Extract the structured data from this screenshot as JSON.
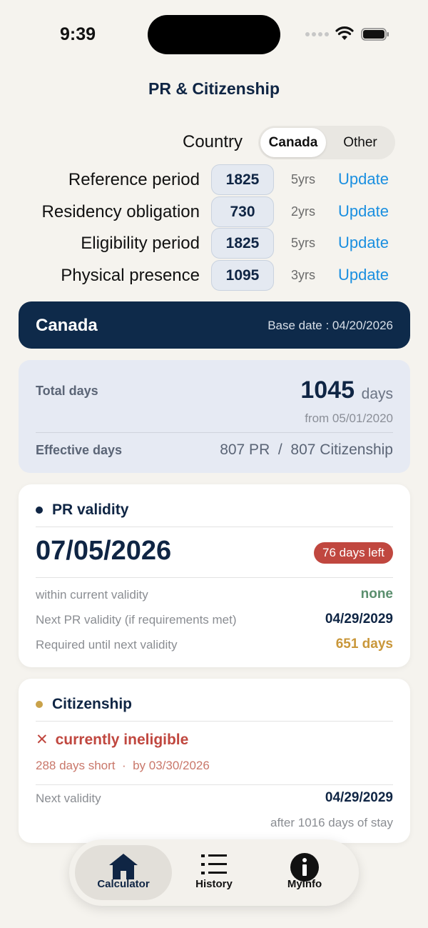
{
  "status_bar": {
    "time": "9:39"
  },
  "app": {
    "title": "PR & Citizenship"
  },
  "country": {
    "label": "Country",
    "options": [
      "Canada",
      "Other"
    ],
    "selected": "Canada"
  },
  "settings": [
    {
      "label": "Reference period",
      "value": "1825",
      "years": "5yrs",
      "action": "Update"
    },
    {
      "label": "Residency obligation",
      "value": "730",
      "years": "2yrs",
      "action": "Update"
    },
    {
      "label": "Eligibility period",
      "value": "1825",
      "years": "5yrs",
      "action": "Update"
    },
    {
      "label": "Physical presence",
      "value": "1095",
      "years": "3yrs",
      "action": "Update"
    }
  ],
  "header": {
    "country": "Canada",
    "base_date": "Base date : 04/20/2026"
  },
  "summary": {
    "total_label": "Total days",
    "total_value": "1045",
    "total_unit": "days",
    "from": "from 05/01/2020",
    "effective_label": "Effective days",
    "effective_value": "807 PR  /  807 Citizenship"
  },
  "pr_card": {
    "title": "PR validity",
    "date": "07/05/2026",
    "badge": "76 days left",
    "rows": [
      {
        "label": "within current validity",
        "value": "none",
        "color": "#5b8f6e"
      },
      {
        "label": "Next PR validity (if requirements met)",
        "value": "04/29/2029",
        "color": "#0f2544"
      },
      {
        "label": "Required until next validity",
        "value": "651 days",
        "color": "#c9973a"
      }
    ],
    "dot_color": "#0f2544"
  },
  "citizenship_card": {
    "title": "Citizenship",
    "status_icon": "✕",
    "status": "currently ineligible",
    "short": "288 days short  ·  by 03/30/2026",
    "next_label": "Next validity",
    "next_value": "04/29/2029",
    "after_stay": "after 1016 days of stay",
    "dot_color": "#c9a24a"
  },
  "tabs": [
    {
      "label": "Calculator",
      "icon": "home-icon",
      "active": true
    },
    {
      "label": "History",
      "icon": "list-icon",
      "active": false
    },
    {
      "label": "MyInfo",
      "icon": "info-icon",
      "active": false
    }
  ]
}
